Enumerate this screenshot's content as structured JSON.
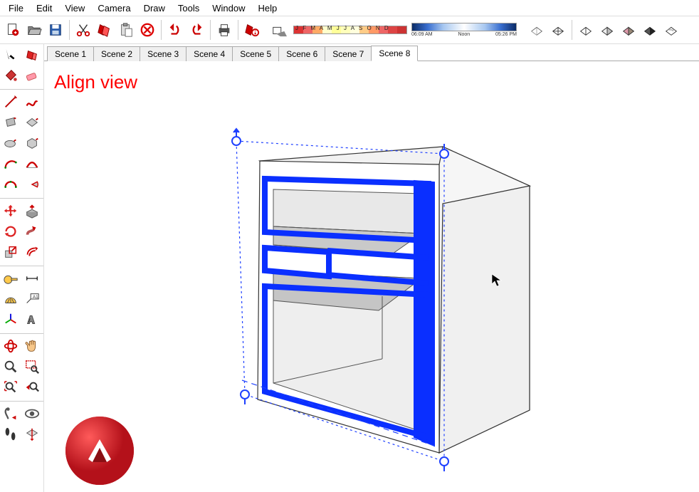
{
  "menu": {
    "file": "File",
    "edit": "Edit",
    "view": "View",
    "camera": "Camera",
    "draw": "Draw",
    "tools": "Tools",
    "window": "Window",
    "help": "Help"
  },
  "shadow": {
    "months": "J F M A M J J A S O N D",
    "time_start": "06:09 AM",
    "time_noon": "Noon",
    "time_end": "05:26 PM"
  },
  "scenes": {
    "tabs": [
      {
        "label": "Scene 1"
      },
      {
        "label": "Scene 2"
      },
      {
        "label": "Scene 3"
      },
      {
        "label": "Scene 4"
      },
      {
        "label": "Scene 5"
      },
      {
        "label": "Scene 6"
      },
      {
        "label": "Scene 7"
      },
      {
        "label": "Scene 8"
      }
    ],
    "active": 7
  },
  "viewport": {
    "overlay_text": "Align view"
  },
  "colors": {
    "selection": "#0a2fff",
    "overlay_text": "#ff0000"
  }
}
